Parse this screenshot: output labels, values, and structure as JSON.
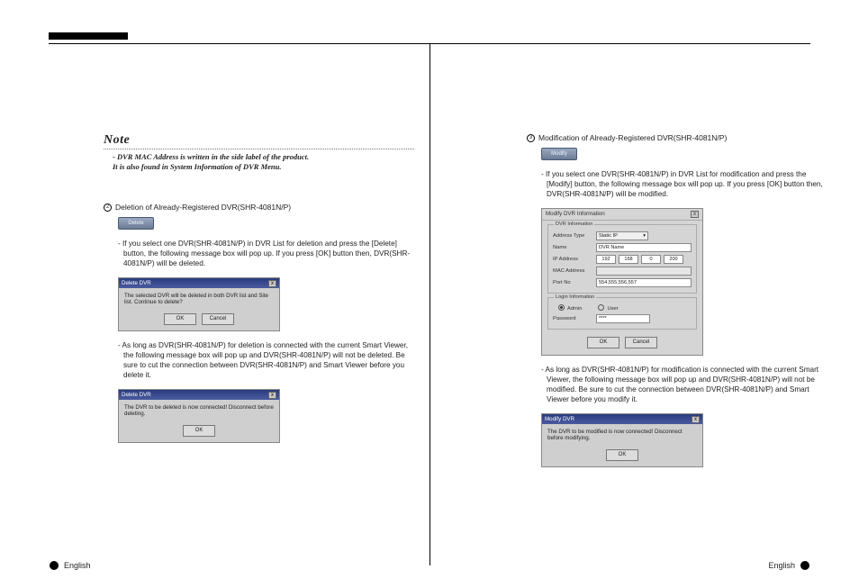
{
  "left": {
    "note_title": "Note",
    "note_line1": "- DVR MAC Address is written in the side label of the product.",
    "note_line2": "  It is also found in System Information of DVR Menu.",
    "s2_num": "2",
    "s2_title": "Deletion of Already-Registered DVR(SHR-4081N/P)",
    "s2_btn": "Delete",
    "s2_p1": "- If you select one DVR(SHR-4081N/P) in DVR List for deletion and press the [Delete] button, the following message box will pop up. If you press [OK] button then, DVR(SHR-4081N/P) will be deleted.",
    "dlg1_title": "Delete DVR",
    "dlg1_msg": "The selected DVR will be deleted in both DVR list and Site list. Continue to delete?",
    "dlg1_ok": "OK",
    "dlg1_cancel": "Cancel",
    "s2_p2": "- As long as DVR(SHR-4081N/P) for deletion is connected with the current Smart Viewer, the following message box will pop up and DVR(SHR-4081N/P) will not be deleted. Be sure to cut the connection between DVR(SHR-4081N/P) and Smart Viewer before you delete it.",
    "dlg2_title": "Delete DVR",
    "dlg2_msg": "The DVR to be deleted is now connected! Disconnect before deleting.",
    "dlg2_ok": "OK"
  },
  "right": {
    "s3_num": "3",
    "s3_title": "Modification of Already-Registered DVR(SHR-4081N/P)",
    "s3_btn": "Modify",
    "s3_p1": "- If you select one DVR(SHR-4081N/P) in DVR List for modification and press the [Modify] button, the following message box will pop up. If you press [OK] button then, DVR(SHR-4081N/P) will be modified.",
    "form_title": "Modify DVR Information",
    "grp1": "DVR Information",
    "lbl_addrtype": "Address Type",
    "val_addrtype": "Static IP",
    "lbl_name": "Name",
    "val_name": "DVR Name",
    "lbl_ip": "IP Address",
    "ip1": "192",
    "ip2": "168",
    "ip3": "0",
    "ip4": "200",
    "lbl_mac": "MAC Address",
    "lbl_port": "Port No",
    "val_port": "554,555,556,557",
    "grp2": "Login Information",
    "rad_admin": "Admin",
    "rad_user": "User",
    "lbl_pwd": "Password",
    "val_pwd": "****",
    "form_ok": "OK",
    "form_cancel": "Cancel",
    "s3_p2": "- As long as DVR(SHR-4081N/P) for modification is connected with the current Smart Viewer, the following message box will pop up and DVR(SHR-4081N/P) will not be modified. Be sure to cut the connection between DVR(SHR-4081N/P) and Smart Viewer before you modify it.",
    "dlg3_title": "Modify DVR",
    "dlg3_msg": "The DVR to be modified is now connected! Disconnect before modifying.",
    "dlg3_ok": "OK"
  },
  "footer": {
    "lang": "English"
  }
}
